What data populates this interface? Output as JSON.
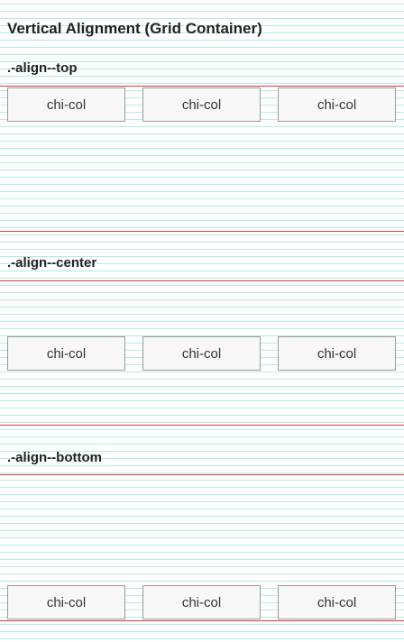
{
  "page_title": "Vertical Alignment (Grid Container)",
  "sections": [
    {
      "title": ".-align--top",
      "cells": [
        "chi-col",
        "chi-col",
        "chi-col"
      ]
    },
    {
      "title": ".-align--center",
      "cells": [
        "chi-col",
        "chi-col",
        "chi-col"
      ]
    },
    {
      "title": ".-align--bottom",
      "cells": [
        "chi-col",
        "chi-col",
        "chi-col"
      ]
    }
  ],
  "colors": {
    "baseline_grid": "#b3ece2",
    "container_border": "#d63a3a",
    "cell_background": "#f8f8f8",
    "cell_border": "#9a9a9a"
  }
}
